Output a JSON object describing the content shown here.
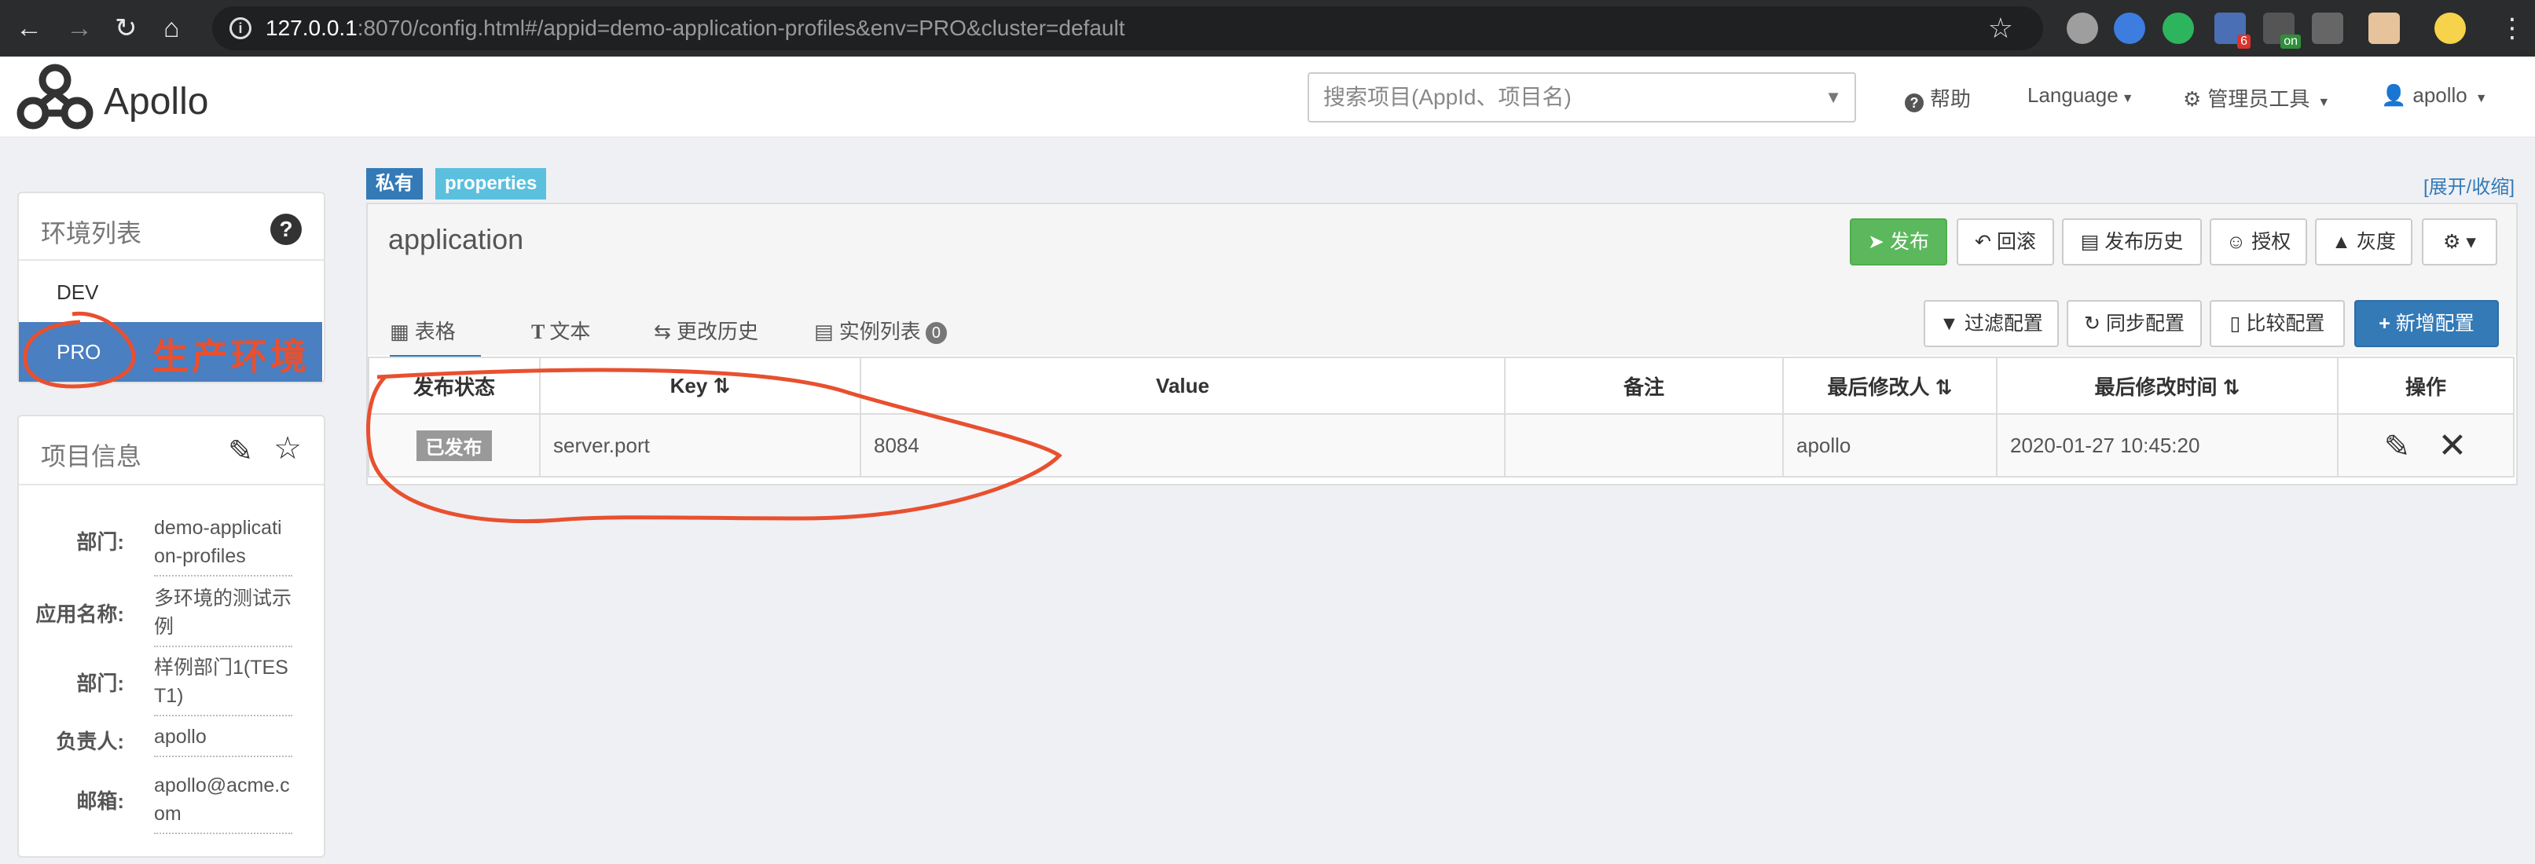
{
  "browser": {
    "url_host": "127.0.0.1",
    "url_rest": ":8070/config.html#/appid=demo-application-profiles&env=PRO&cluster=default",
    "ext_badges": [
      "6",
      "on"
    ]
  },
  "header": {
    "brand": "Apollo",
    "search_placeholder": "搜索项目(AppId、项目名)",
    "help": "帮助",
    "language": "Language",
    "admin_tools": "管理员工具",
    "user": "apollo"
  },
  "env_panel": {
    "title": "环境列表",
    "items": [
      {
        "label": "DEV",
        "active": false
      },
      {
        "label": "PRO",
        "active": true
      }
    ],
    "annotation": "生产环境"
  },
  "project_info": {
    "title": "项目信息",
    "rows": [
      {
        "key": "部门:",
        "value": "demo-application-profiles"
      },
      {
        "key": "应用名称:",
        "value": "多环境的测试示例"
      },
      {
        "key": "部门:",
        "value": "样例部门1(TEST1)"
      },
      {
        "key": "负责人:",
        "value": "apollo"
      },
      {
        "key": "邮箱:",
        "value": "apollo@acme.com"
      }
    ]
  },
  "namespace": {
    "tag_private": "私有",
    "tag_format": "properties",
    "expand_toggle": "[展开/收缩]",
    "name": "application",
    "buttons": {
      "publish": "发布",
      "rollback": "回滚",
      "history": "发布历史",
      "auth": "授权",
      "gray": "灰度",
      "filter": "过滤配置",
      "sync": "同步配置",
      "compare": "比较配置",
      "add": "新增配置"
    },
    "tabs": [
      {
        "label": "表格",
        "active": true
      },
      {
        "label": "文本",
        "active": false
      },
      {
        "label": "更改历史",
        "active": false
      },
      {
        "label": "实例列表",
        "active": false,
        "badge": "0"
      }
    ],
    "columns": [
      "发布状态",
      "Key",
      "Value",
      "备注",
      "最后修改人",
      "最后修改时间",
      "操作"
    ],
    "rows": [
      {
        "status": "已发布",
        "key": "server.port",
        "value": "8084",
        "comment": "",
        "modifier": "apollo",
        "modified_time": "2020-01-27 10:45:20"
      }
    ]
  },
  "colors": {
    "accent": "#337ab7",
    "active_env": "#4a7fc1",
    "publish_green": "#5cb85c",
    "annotation_red": "#e8502f",
    "tag_format": "#5bc0de"
  }
}
